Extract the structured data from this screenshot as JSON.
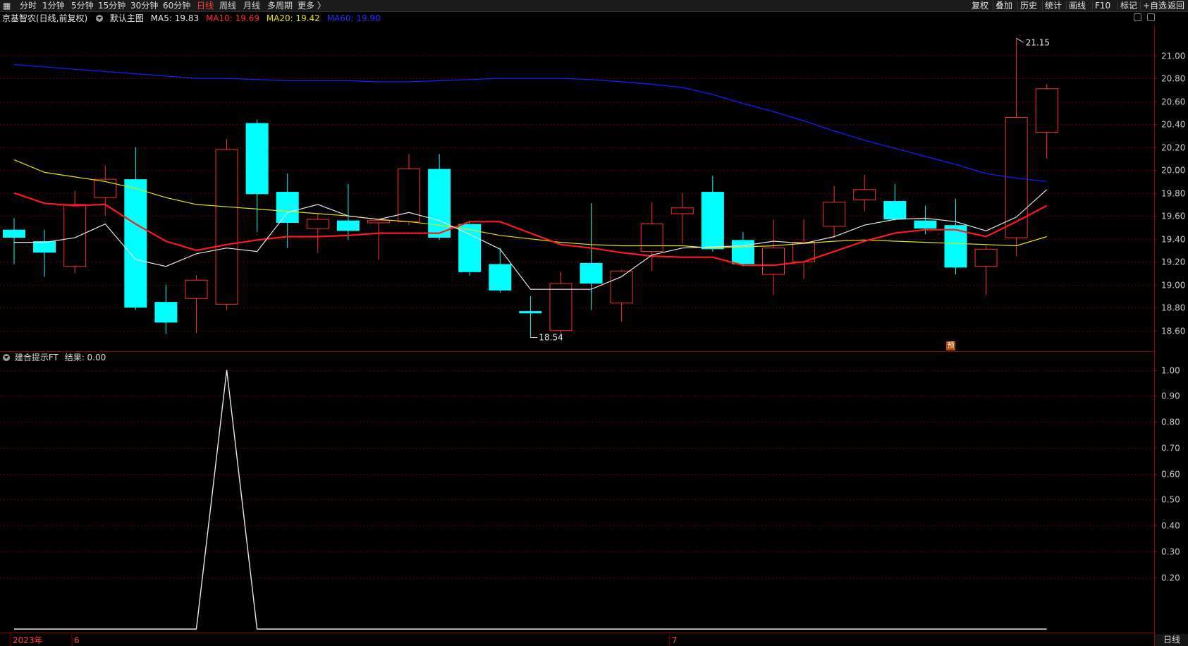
{
  "toolbar": {
    "periods": [
      "分时",
      "1分钟",
      "5分钟",
      "15分钟",
      "30分钟",
      "60分钟",
      "日线",
      "周线",
      "月线",
      "多周期",
      "更多 〉"
    ],
    "active_period": "日线",
    "right_items": [
      "复权",
      "叠加",
      "历史",
      "统计",
      "画线",
      "F10",
      "标记",
      "+自选",
      "返回"
    ]
  },
  "main_legend": {
    "stock": "京基智农(日线,前复权)",
    "layout": "默认主图",
    "ma5": "MA5: 19.83",
    "ma10": "MA10: 19.69",
    "ma20": "MA20: 19.42",
    "ma60": "MA60: 19.90"
  },
  "sub_legend": {
    "name": "建合提示FT",
    "result": "结果: 0.00"
  },
  "annotations": {
    "high": "21.15",
    "low": "18.54",
    "forecast_marker": "预"
  },
  "x_axis": {
    "labels": [
      {
        "text": "2023年",
        "index": 0
      },
      {
        "text": "6",
        "index": 2
      },
      {
        "text": "7",
        "index": 22
      }
    ]
  },
  "period_label": "日线",
  "colors": {
    "up": "#ff3030",
    "down": "#00ffff",
    "ma5": "#e6e6e6",
    "ma10": "#ff1a1a",
    "ma20": "#e6e600",
    "ma60": "#1a1aff",
    "axis": "#8b0000",
    "grid": "#5a0000"
  },
  "chart_data": [
    {
      "type": "candlestick",
      "y_ticks": [
        18.6,
        18.8,
        19.0,
        19.2,
        19.4,
        19.6,
        19.8,
        20.0,
        20.2,
        20.4,
        20.6,
        20.8,
        21.0
      ],
      "ylim": [
        18.42,
        21.25
      ],
      "candles": [
        {
          "o": 19.48,
          "h": 19.58,
          "l": 19.18,
          "c": 19.41
        },
        {
          "o": 19.38,
          "h": 19.48,
          "l": 19.07,
          "c": 19.28
        },
        {
          "o": 19.16,
          "h": 19.82,
          "l": 19.1,
          "c": 19.7
        },
        {
          "o": 19.76,
          "h": 20.04,
          "l": 19.6,
          "c": 19.92
        },
        {
          "o": 19.92,
          "h": 20.2,
          "l": 18.78,
          "c": 18.8
        },
        {
          "o": 18.85,
          "h": 19.0,
          "l": 18.57,
          "c": 18.67
        },
        {
          "o": 18.88,
          "h": 19.08,
          "l": 18.58,
          "c": 19.04
        },
        {
          "o": 18.83,
          "h": 20.27,
          "l": 18.78,
          "c": 20.18
        },
        {
          "o": 20.41,
          "h": 20.44,
          "l": 19.46,
          "c": 19.79
        },
        {
          "o": 19.81,
          "h": 19.97,
          "l": 19.32,
          "c": 19.54
        },
        {
          "o": 19.49,
          "h": 19.62,
          "l": 19.28,
          "c": 19.57
        },
        {
          "o": 19.56,
          "h": 19.88,
          "l": 19.39,
          "c": 19.47
        },
        {
          "o": 19.54,
          "h": 19.56,
          "l": 19.22,
          "c": 19.56
        },
        {
          "o": 19.55,
          "h": 20.14,
          "l": 19.52,
          "c": 20.01
        },
        {
          "o": 20.01,
          "h": 20.14,
          "l": 19.39,
          "c": 19.41
        },
        {
          "o": 19.53,
          "h": 19.56,
          "l": 19.08,
          "c": 19.11
        },
        {
          "o": 19.18,
          "h": 19.32,
          "l": 18.93,
          "c": 18.95
        },
        {
          "o": 18.77,
          "h": 18.9,
          "l": 18.54,
          "c": 18.75
        },
        {
          "o": 18.6,
          "h": 19.11,
          "l": 18.58,
          "c": 19.01
        },
        {
          "o": 19.19,
          "h": 19.71,
          "l": 18.78,
          "c": 19.01
        },
        {
          "o": 18.84,
          "h": 19.13,
          "l": 18.68,
          "c": 19.12
        },
        {
          "o": 19.29,
          "h": 19.72,
          "l": 19.12,
          "c": 19.53
        },
        {
          "o": 19.62,
          "h": 19.8,
          "l": 19.36,
          "c": 19.67
        },
        {
          "o": 19.81,
          "h": 19.95,
          "l": 19.29,
          "c": 19.31
        },
        {
          "o": 19.39,
          "h": 19.46,
          "l": 19.16,
          "c": 19.18
        },
        {
          "o": 19.09,
          "h": 19.57,
          "l": 18.91,
          "c": 19.32
        },
        {
          "o": 19.2,
          "h": 19.57,
          "l": 19.05,
          "c": 19.37
        },
        {
          "o": 19.51,
          "h": 19.86,
          "l": 19.41,
          "c": 19.72
        },
        {
          "o": 19.74,
          "h": 19.96,
          "l": 19.64,
          "c": 19.83
        },
        {
          "o": 19.73,
          "h": 19.88,
          "l": 19.56,
          "c": 19.57
        },
        {
          "o": 19.56,
          "h": 19.69,
          "l": 19.44,
          "c": 19.49
        },
        {
          "o": 19.52,
          "h": 19.75,
          "l": 19.09,
          "c": 19.15
        },
        {
          "o": 19.16,
          "h": 19.34,
          "l": 18.91,
          "c": 19.31
        },
        {
          "o": 19.41,
          "h": 21.15,
          "l": 19.25,
          "c": 20.46
        },
        {
          "o": 20.33,
          "h": 20.75,
          "l": 20.1,
          "c": 20.71
        }
      ],
      "ma5": [
        19.37,
        19.37,
        19.41,
        19.53,
        19.22,
        19.16,
        19.27,
        19.32,
        19.29,
        19.63,
        19.7,
        19.6,
        19.57,
        19.63,
        19.56,
        19.44,
        19.31,
        18.96,
        18.96,
        18.96,
        19.07,
        19.26,
        19.32,
        19.33,
        19.34,
        19.38,
        19.36,
        19.42,
        19.52,
        19.57,
        19.58,
        19.55,
        19.47,
        19.59,
        19.83
      ],
      "ma10": [
        19.8,
        19.71,
        19.69,
        19.7,
        19.53,
        19.38,
        19.3,
        19.35,
        19.39,
        19.42,
        19.42,
        19.43,
        19.45,
        19.45,
        19.45,
        19.55,
        19.55,
        19.45,
        19.35,
        19.32,
        19.28,
        19.25,
        19.24,
        19.24,
        19.17,
        19.17,
        19.2,
        19.29,
        19.38,
        19.45,
        19.48,
        19.48,
        19.42,
        19.55,
        19.69
      ],
      "ma20": [
        20.09,
        19.98,
        19.94,
        19.9,
        19.84,
        19.76,
        19.7,
        19.68,
        19.66,
        19.64,
        19.62,
        19.6,
        19.57,
        19.55,
        19.52,
        19.48,
        19.43,
        19.4,
        19.37,
        19.35,
        19.34,
        19.34,
        19.34,
        19.32,
        19.33,
        19.34,
        19.36,
        19.38,
        19.39,
        19.38,
        19.37,
        19.36,
        19.35,
        19.34,
        19.42
      ],
      "ma60": [
        20.92,
        20.9,
        20.88,
        20.86,
        20.84,
        20.82,
        20.8,
        20.8,
        20.79,
        20.78,
        20.78,
        20.78,
        20.77,
        20.77,
        20.78,
        20.79,
        20.8,
        20.8,
        20.8,
        20.79,
        20.77,
        20.75,
        20.72,
        20.66,
        20.58,
        20.51,
        20.43,
        20.34,
        20.26,
        20.19,
        20.12,
        20.05,
        19.97,
        19.93,
        19.9
      ]
    },
    {
      "type": "line",
      "title": "建合提示FT",
      "y_ticks": [
        0.2,
        0.3,
        0.4,
        0.5,
        0.6,
        0.7,
        0.8,
        0.9,
        1.0
      ],
      "ylim": [
        0,
        1.04
      ],
      "values": [
        0,
        0,
        0,
        0,
        0,
        0,
        0,
        1,
        0,
        0,
        0,
        0,
        0,
        0,
        0,
        0,
        0,
        0,
        0,
        0,
        0,
        0,
        0,
        0,
        0,
        0,
        0,
        0,
        0,
        0,
        0,
        0,
        0,
        0,
        0
      ]
    }
  ]
}
